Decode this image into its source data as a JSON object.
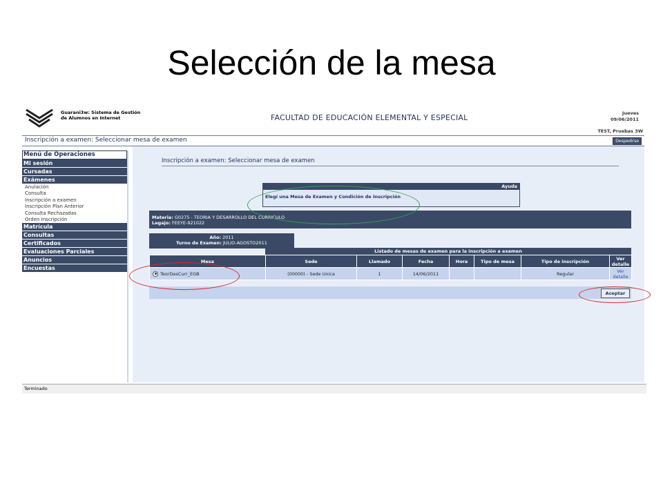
{
  "slide": {
    "title": "Selección de la mesa"
  },
  "header": {
    "system_line1": "Guarani3w: Sistema de Gestión",
    "system_line2": "de Alumnos en Internet",
    "faculty": "FACULTAD DE EDUCACIÓN ELEMENTAL Y ESPECIAL",
    "day": "Jueves",
    "date": "09/06/2011",
    "user": "TEST, Pruebas 3W",
    "breadcrumb": "Inscripción a examen: Seleccionar mesa de examen",
    "logout_label": "Despedirse"
  },
  "sidebar": {
    "title": "Menú de Operaciones",
    "sections": [
      {
        "label": "Mi sesión"
      },
      {
        "label": "Cursadas"
      },
      {
        "label": "Exámenes",
        "items": [
          "Anulación",
          "Consulta",
          "Inscripción a examen",
          "Inscripción Plan Anterior",
          "Consulta Rechazadas",
          "Orden Inscripción"
        ]
      },
      {
        "label": "Matrícula"
      },
      {
        "label": "Consultas"
      },
      {
        "label": "Certificados"
      },
      {
        "label": "Evaluaciones Parciales"
      },
      {
        "label": "Anuncios"
      },
      {
        "label": "Encuestas"
      }
    ]
  },
  "main": {
    "title": "Inscripción a examen: Seleccionar mesa de examen",
    "help": {
      "header": "Ayuda",
      "text": "Elegí una Mesa de Examen y Condición de Inscripción"
    },
    "materia_label": "Materia:",
    "materia_value": "G0275 - TEORIA Y DESARROLLO DEL CURRICULO",
    "legajo_label": "Legajo:",
    "legajo_value": "FEEYE-921022",
    "anio_label": "Año:",
    "anio_value": "2011",
    "turno_label": "Turno de Examen:",
    "turno_value": "JULIO-AGOSTO2011",
    "table": {
      "caption": "Listado de mesas de examen para la inscripción a examen",
      "columns": [
        "Mesa",
        "Sede",
        "Llamado",
        "Fecha",
        "Hora",
        "Tipo de mesa",
        "Tipo de inscripción",
        "Ver detalle"
      ],
      "rows": [
        {
          "mesa": "TeorDesCurr_EGB",
          "sede": "(00000) - Sede Unica",
          "llamado": "1",
          "fecha": "14/06/2011",
          "hora": "",
          "tipo_mesa": "",
          "tipo_inscripcion": "Regular",
          "ver_detalle": "Ver detalle"
        }
      ]
    },
    "accept_label": "Aceptar"
  },
  "status_bar": {
    "text": "Terminado"
  },
  "colors": {
    "header_navy": "#3a4a66",
    "annotation_green": "#2fa84f",
    "annotation_red": "#d42a2a"
  }
}
